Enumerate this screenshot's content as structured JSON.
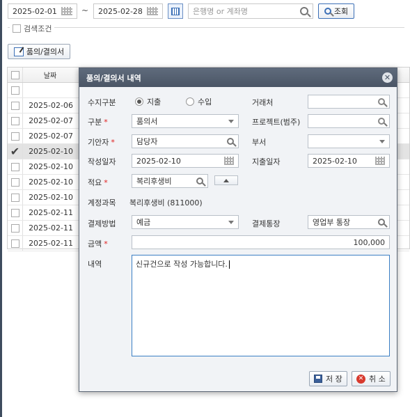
{
  "toolbar": {
    "date_from": "2025-02-01",
    "date_sep": "~",
    "date_to": "2025-02-28",
    "search_placeholder": "은행명 or 계좌명",
    "search_button": "조회",
    "search_conditions": "검색조건",
    "approval_button": "품의/결의서"
  },
  "grid": {
    "col_date": "날짜",
    "rows": [
      {
        "date": "",
        "checked": false,
        "selected": false
      },
      {
        "date": "2025-02-06",
        "checked": false,
        "selected": false
      },
      {
        "date": "2025-02-07",
        "checked": false,
        "selected": false
      },
      {
        "date": "2025-02-07",
        "checked": false,
        "selected": false
      },
      {
        "date": "2025-02-10",
        "checked": true,
        "selected": true
      },
      {
        "date": "2025-02-10",
        "checked": false,
        "selected": false
      },
      {
        "date": "2025-02-10",
        "checked": false,
        "selected": false
      },
      {
        "date": "2025-02-10",
        "checked": false,
        "selected": false
      },
      {
        "date": "2025-02-11",
        "checked": false,
        "selected": false
      },
      {
        "date": "2025-02-11",
        "checked": false,
        "selected": false
      },
      {
        "date": "2025-02-11",
        "checked": false,
        "selected": false
      }
    ]
  },
  "modal": {
    "title": "품의/결의서 내역",
    "close_symbol": "✕",
    "labels": {
      "type_inout": "수지구분",
      "partner": "거래처",
      "category": "구분",
      "project": "프로젝트(범주)",
      "drafter": "기안자",
      "department": "부서",
      "created_date": "작성일자",
      "expense_date": "지출일자",
      "summary": "적요",
      "account": "계정과목",
      "pay_method": "결제방법",
      "pay_account": "결제통장",
      "amount": "금액",
      "content": "내역"
    },
    "required_mark": "*",
    "radio_expense": "지출",
    "radio_income": "수입",
    "radio_selected": "지출",
    "category_value": "품의서",
    "drafter_value": "담당자",
    "created_date_value": "2025-02-10",
    "expense_date_value": "2025-02-10",
    "summary_value": "복리후생비",
    "account_value": "복리후생비 (811000)",
    "pay_method_value": "예금",
    "pay_account_value": "영업부 통장",
    "amount_value": "100,000",
    "content_value": "신규건으로 작성 가능합니다.",
    "save_button": "저 장",
    "cancel_button": "취 소"
  },
  "colors": {
    "modal_header": "#4a5565",
    "accent": "#3b6fb6",
    "required": "#e02020"
  }
}
